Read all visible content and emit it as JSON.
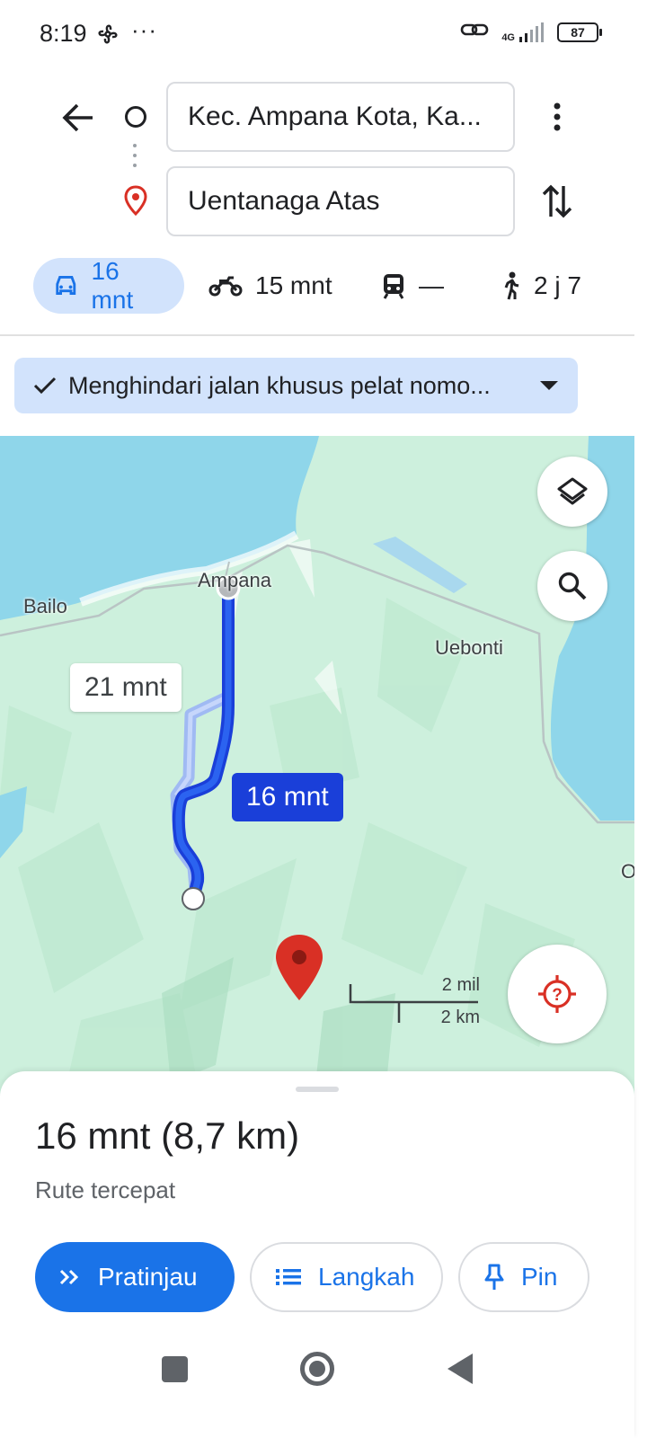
{
  "status_bar": {
    "time": "8:19",
    "dots": "···",
    "network": "4G",
    "battery": "87"
  },
  "directions": {
    "origin": "Kec. Ampana Kota, Ka...",
    "destination": "Uentanaga Atas"
  },
  "modes": {
    "car": "16 mnt",
    "motorcycle": "15 mnt",
    "transit": "—",
    "walk": "2 j 7"
  },
  "options_chip": {
    "label": "Menghindari jalan khusus pelat nomo..."
  },
  "map": {
    "labels": {
      "ampana": "Ampana",
      "bailo": "Bailo",
      "uebonti": "Uebonti",
      "edge": "O"
    },
    "alt_route_time": "21 mnt",
    "main_route_time": "16 mnt",
    "scale_mi": "2 mil",
    "scale_km": "2 km"
  },
  "sheet": {
    "summary": "16 mnt (8,7 km)",
    "description": "Rute tercepat",
    "preview_label": "Pratinjau",
    "steps_label": "Langkah",
    "pin_label": "Pin"
  },
  "colors": {
    "accent": "#1a73e8",
    "route_main": "#1a3fd9",
    "route_alt": "#9bb4f5",
    "water": "#8fd6ea",
    "land": "#cdf0dd",
    "pin_red": "#d93025"
  },
  "icons": [
    "back-arrow-icon",
    "origin-circle-icon",
    "destination-pin-icon",
    "more-vert-icon",
    "swap-icon",
    "car-icon",
    "motorcycle-icon",
    "train-icon",
    "walk-icon",
    "check-icon",
    "dropdown-icon",
    "layers-icon",
    "search-icon",
    "locate-icon",
    "double-chevron-icon",
    "list-icon",
    "pin-icon"
  ]
}
